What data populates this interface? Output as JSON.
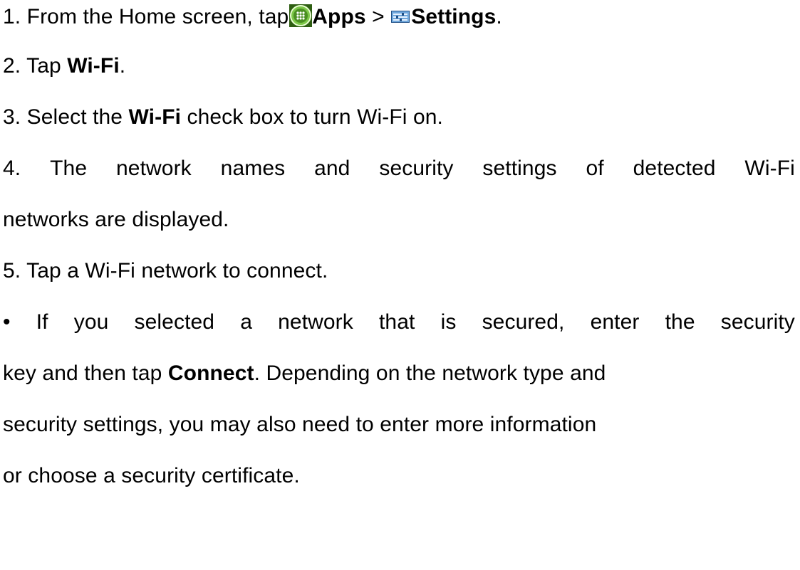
{
  "instructions": {
    "step1": {
      "prefix": "1. From the Home screen, tap",
      "apps_label": "Apps",
      "separator": " > ",
      "settings_label": "Settings",
      "suffix": ".",
      "apps_icon": "apps-launcher-icon",
      "settings_icon": "settings-icon"
    },
    "step2": {
      "prefix": "2. Tap ",
      "bold": "Wi-Fi",
      "suffix": "."
    },
    "step3": {
      "prefix": "3. Select the ",
      "bold": "Wi-Fi",
      "suffix": " check box to turn Wi-Fi on."
    },
    "step4": {
      "line1_words": [
        "4.",
        "The",
        "network",
        "names",
        "and",
        "security",
        "settings",
        "of",
        "detected",
        "Wi-Fi"
      ],
      "line2": "networks are displayed."
    },
    "step5": {
      "text": "5. Tap a Wi-Fi network to connect."
    },
    "note": {
      "line1_words": [
        "•",
        "If",
        "you",
        "selected",
        "a",
        "network",
        "that",
        "is",
        "secured,",
        "enter",
        "the",
        "security"
      ],
      "line2_prefix": "key and then tap ",
      "line2_bold": "Connect",
      "line2_suffix": ". Depending on the network type and",
      "line3": "security settings, you may also need to enter more information",
      "line4": "or choose a security certificate."
    }
  },
  "colors": {
    "text": "#000000",
    "background": "#ffffff",
    "apps_icon_fill": "#5aa02c",
    "settings_icon_fill": "#3b6ea8"
  }
}
